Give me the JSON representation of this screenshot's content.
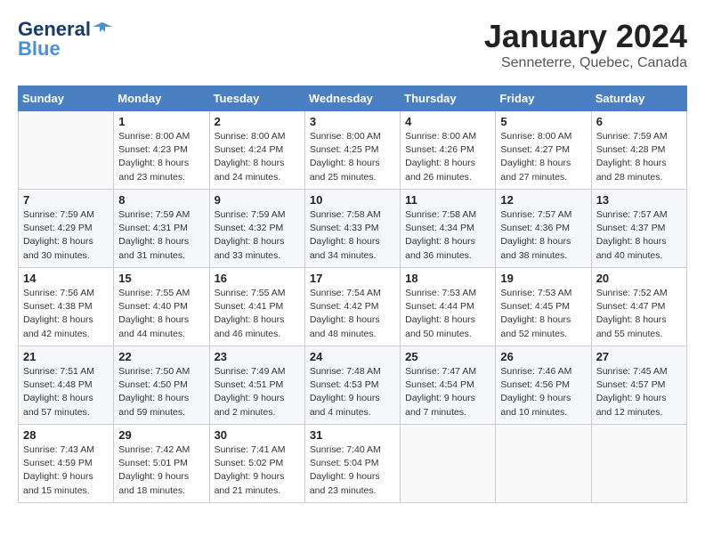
{
  "header": {
    "logo_line1": "General",
    "logo_line2": "Blue",
    "month_title": "January 2024",
    "location": "Senneterre, Quebec, Canada"
  },
  "calendar": {
    "days_of_week": [
      "Sunday",
      "Monday",
      "Tuesday",
      "Wednesday",
      "Thursday",
      "Friday",
      "Saturday"
    ],
    "weeks": [
      [
        {
          "day": "",
          "info": ""
        },
        {
          "day": "1",
          "info": "Sunrise: 8:00 AM\nSunset: 4:23 PM\nDaylight: 8 hours\nand 23 minutes."
        },
        {
          "day": "2",
          "info": "Sunrise: 8:00 AM\nSunset: 4:24 PM\nDaylight: 8 hours\nand 24 minutes."
        },
        {
          "day": "3",
          "info": "Sunrise: 8:00 AM\nSunset: 4:25 PM\nDaylight: 8 hours\nand 25 minutes."
        },
        {
          "day": "4",
          "info": "Sunrise: 8:00 AM\nSunset: 4:26 PM\nDaylight: 8 hours\nand 26 minutes."
        },
        {
          "day": "5",
          "info": "Sunrise: 8:00 AM\nSunset: 4:27 PM\nDaylight: 8 hours\nand 27 minutes."
        },
        {
          "day": "6",
          "info": "Sunrise: 7:59 AM\nSunset: 4:28 PM\nDaylight: 8 hours\nand 28 minutes."
        }
      ],
      [
        {
          "day": "7",
          "info": "Sunrise: 7:59 AM\nSunset: 4:29 PM\nDaylight: 8 hours\nand 30 minutes."
        },
        {
          "day": "8",
          "info": "Sunrise: 7:59 AM\nSunset: 4:31 PM\nDaylight: 8 hours\nand 31 minutes."
        },
        {
          "day": "9",
          "info": "Sunrise: 7:59 AM\nSunset: 4:32 PM\nDaylight: 8 hours\nand 33 minutes."
        },
        {
          "day": "10",
          "info": "Sunrise: 7:58 AM\nSunset: 4:33 PM\nDaylight: 8 hours\nand 34 minutes."
        },
        {
          "day": "11",
          "info": "Sunrise: 7:58 AM\nSunset: 4:34 PM\nDaylight: 8 hours\nand 36 minutes."
        },
        {
          "day": "12",
          "info": "Sunrise: 7:57 AM\nSunset: 4:36 PM\nDaylight: 8 hours\nand 38 minutes."
        },
        {
          "day": "13",
          "info": "Sunrise: 7:57 AM\nSunset: 4:37 PM\nDaylight: 8 hours\nand 40 minutes."
        }
      ],
      [
        {
          "day": "14",
          "info": "Sunrise: 7:56 AM\nSunset: 4:38 PM\nDaylight: 8 hours\nand 42 minutes."
        },
        {
          "day": "15",
          "info": "Sunrise: 7:55 AM\nSunset: 4:40 PM\nDaylight: 8 hours\nand 44 minutes."
        },
        {
          "day": "16",
          "info": "Sunrise: 7:55 AM\nSunset: 4:41 PM\nDaylight: 8 hours\nand 46 minutes."
        },
        {
          "day": "17",
          "info": "Sunrise: 7:54 AM\nSunset: 4:42 PM\nDaylight: 8 hours\nand 48 minutes."
        },
        {
          "day": "18",
          "info": "Sunrise: 7:53 AM\nSunset: 4:44 PM\nDaylight: 8 hours\nand 50 minutes."
        },
        {
          "day": "19",
          "info": "Sunrise: 7:53 AM\nSunset: 4:45 PM\nDaylight: 8 hours\nand 52 minutes."
        },
        {
          "day": "20",
          "info": "Sunrise: 7:52 AM\nSunset: 4:47 PM\nDaylight: 8 hours\nand 55 minutes."
        }
      ],
      [
        {
          "day": "21",
          "info": "Sunrise: 7:51 AM\nSunset: 4:48 PM\nDaylight: 8 hours\nand 57 minutes."
        },
        {
          "day": "22",
          "info": "Sunrise: 7:50 AM\nSunset: 4:50 PM\nDaylight: 8 hours\nand 59 minutes."
        },
        {
          "day": "23",
          "info": "Sunrise: 7:49 AM\nSunset: 4:51 PM\nDaylight: 9 hours\nand 2 minutes."
        },
        {
          "day": "24",
          "info": "Sunrise: 7:48 AM\nSunset: 4:53 PM\nDaylight: 9 hours\nand 4 minutes."
        },
        {
          "day": "25",
          "info": "Sunrise: 7:47 AM\nSunset: 4:54 PM\nDaylight: 9 hours\nand 7 minutes."
        },
        {
          "day": "26",
          "info": "Sunrise: 7:46 AM\nSunset: 4:56 PM\nDaylight: 9 hours\nand 10 minutes."
        },
        {
          "day": "27",
          "info": "Sunrise: 7:45 AM\nSunset: 4:57 PM\nDaylight: 9 hours\nand 12 minutes."
        }
      ],
      [
        {
          "day": "28",
          "info": "Sunrise: 7:43 AM\nSunset: 4:59 PM\nDaylight: 9 hours\nand 15 minutes."
        },
        {
          "day": "29",
          "info": "Sunrise: 7:42 AM\nSunset: 5:01 PM\nDaylight: 9 hours\nand 18 minutes."
        },
        {
          "day": "30",
          "info": "Sunrise: 7:41 AM\nSunset: 5:02 PM\nDaylight: 9 hours\nand 21 minutes."
        },
        {
          "day": "31",
          "info": "Sunrise: 7:40 AM\nSunset: 5:04 PM\nDaylight: 9 hours\nand 23 minutes."
        },
        {
          "day": "",
          "info": ""
        },
        {
          "day": "",
          "info": ""
        },
        {
          "day": "",
          "info": ""
        }
      ]
    ]
  }
}
